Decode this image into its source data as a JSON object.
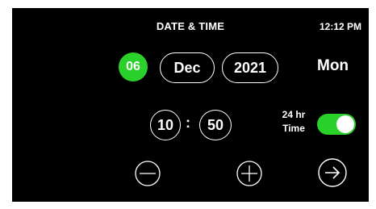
{
  "header": {
    "title": "DATE & TIME",
    "clock": "12:12 PM"
  },
  "date": {
    "day": "06",
    "month": "Dec",
    "year": "2021",
    "weekday": "Mon"
  },
  "time": {
    "hour": "10",
    "separator": ":",
    "minute": "50"
  },
  "format": {
    "label_line1": "24 hr",
    "label_line2": "Time",
    "enabled": true
  },
  "controls": {
    "decrement_icon": "minus-circle-icon",
    "increment_icon": "plus-circle-icon",
    "next_icon": "arrow-right-circle-icon"
  },
  "colors": {
    "accent": "#2bd12b",
    "background": "#000000",
    "foreground": "#ffffff"
  }
}
